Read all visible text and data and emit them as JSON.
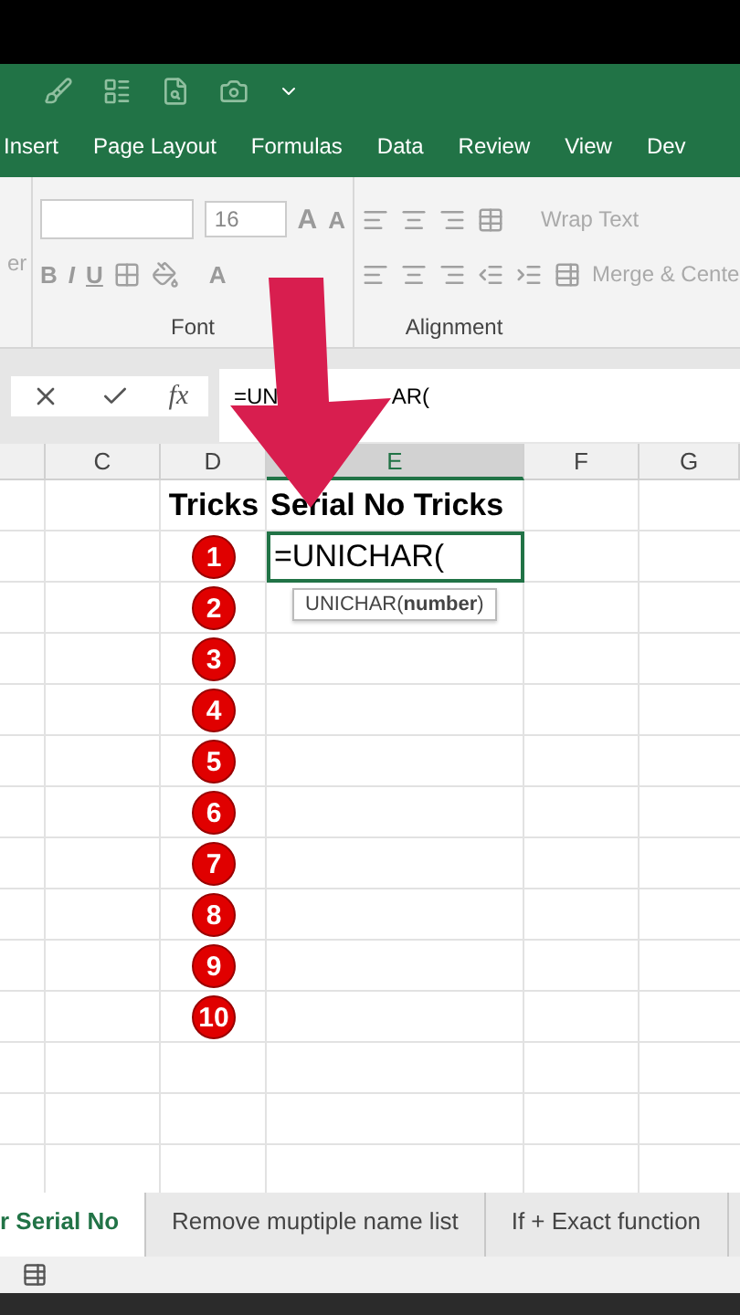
{
  "ribbon_tabs": [
    {
      "label": "Insert",
      "selected": false
    },
    {
      "label": "Page Layout",
      "selected": false
    },
    {
      "label": "Formulas",
      "selected": false
    },
    {
      "label": "Data",
      "selected": false
    },
    {
      "label": "Review",
      "selected": false
    },
    {
      "label": "View",
      "selected": false
    },
    {
      "label": "Dev",
      "selected": false
    }
  ],
  "ribbon": {
    "clipboard_cut_label": "er",
    "font_size": "16",
    "grow_glyph": "A",
    "shrink_glyph": "A",
    "style_buttons": [
      "B",
      "I",
      "U"
    ],
    "font_color_glyph": "A",
    "wrap_text": "Wrap Text",
    "merge": "Merge & Cente",
    "groups": [
      "Font",
      "Alignment"
    ]
  },
  "formula_bar": {
    "fx": "fx",
    "formula_parts": [
      "=UN",
      "AR("
    ]
  },
  "columns": [
    {
      "label": "C",
      "selected": false
    },
    {
      "label": "D",
      "selected": false
    },
    {
      "label": "E",
      "selected": true
    },
    {
      "label": "F",
      "selected": false
    },
    {
      "label": "G",
      "selected": false
    }
  ],
  "sheet": {
    "header_d": "Tricks",
    "header_e": "Serial No Tricks",
    "active_cell": "=UNICHAR(",
    "tooltip": "UNICHAR(**number**)",
    "numbers": [
      "1",
      "2",
      "3",
      "4",
      "5",
      "6",
      "7",
      "8",
      "9",
      "10"
    ]
  },
  "sheet_tabs": [
    {
      "label": "r Serial No",
      "selected": true
    },
    {
      "label": "Remove muptiple name list",
      "selected": false
    },
    {
      "label": "If + Exact  function",
      "selected": false
    }
  ]
}
